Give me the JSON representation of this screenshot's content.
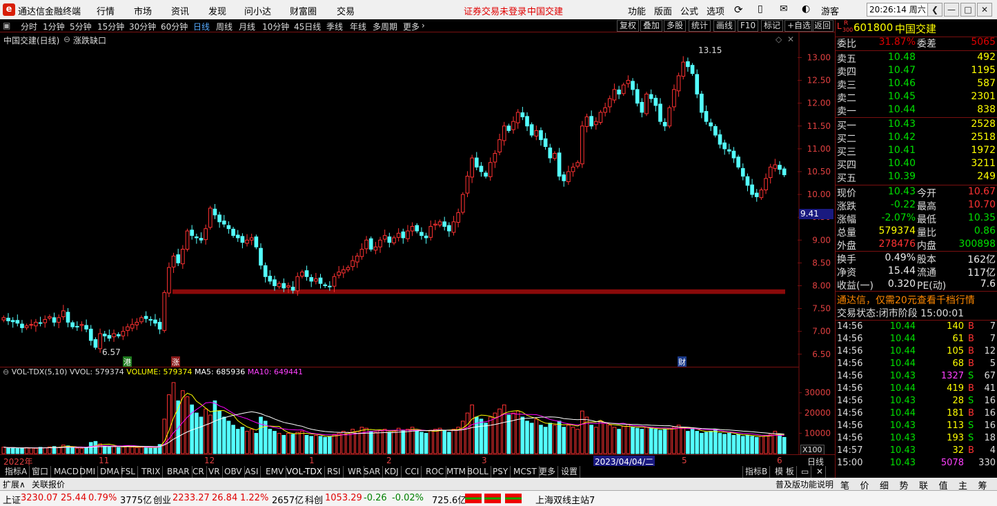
{
  "app": {
    "title": "通达信金融终端",
    "login_status": "证券交易未登录",
    "login_stock": "中国交建",
    "user": "游客",
    "clock": "20:26:14 周六"
  },
  "menus": [
    "行情",
    "市场",
    "资讯",
    "发现",
    "问小达",
    "财富圈",
    "交易"
  ],
  "right_menus": [
    "功能",
    "版面",
    "公式",
    "选项"
  ],
  "periods": [
    "分时",
    "1分钟",
    "5分钟",
    "15分钟",
    "30分钟",
    "60分钟",
    "日线",
    "周线",
    "月线",
    "10分钟",
    "45日线",
    "季线",
    "年线",
    "多周期",
    "更多"
  ],
  "selected_period": "日线",
  "tool_buttons": [
    "复权",
    "叠加",
    "多股",
    "统计",
    "画线",
    "F10",
    "标记",
    "+自选",
    "返回"
  ],
  "chart_title": "中国交建(日线)",
  "chart_indicator": "涨跌缺口",
  "chart_data": {
    "type": "candlestick",
    "title": "中国交建(日线)",
    "ylim": [
      6.3,
      13.4
    ],
    "y_ticks": [
      "13.00",
      "12.50",
      "12.00",
      "11.50",
      "11.00",
      "10.50",
      "10.00",
      "9.50",
      "9.00",
      "8.50",
      "8.00",
      "7.50",
      "7.00",
      "6.50"
    ],
    "x_labels": [
      "2022年",
      "11",
      "12",
      "1",
      "2",
      "3",
      "4",
      "5",
      "6"
    ],
    "cursor_date": "2023/04/04/二",
    "cursor_price": "9.41",
    "max_label": "13.15",
    "min_label": "6.57",
    "gap_band": [
      7.82,
      7.92
    ],
    "markers": [
      "港",
      "涨",
      "财"
    ],
    "closes": [
      7.3,
      7.23,
      7.21,
      7.18,
      7.08,
      7.12,
      7.15,
      7.2,
      7.18,
      7.26,
      7.32,
      7.2,
      7.3,
      7.45,
      7.2,
      7.1,
      7.1,
      7.15,
      7.05,
      6.8,
      6.65,
      6.95,
      6.9,
      6.85,
      6.95,
      6.9,
      7.0,
      7.1,
      7.15,
      7.2,
      7.3,
      7.28,
      7.25,
      7.18,
      7.05,
      7.85,
      8.4,
      8.65,
      8.5,
      8.8,
      9.2,
      9.1,
      9.05,
      9.0,
      9.25,
      9.7,
      9.55,
      9.4,
      9.35,
      9.25,
      9.1,
      9.05,
      8.95,
      9.0,
      9.05,
      8.85,
      8.45,
      8.2,
      8.1,
      8.0,
      8.05,
      7.95,
      8.0,
      7.9,
      8.2,
      8.3,
      8.2,
      8.1,
      8.15,
      8.05,
      8.0,
      7.98,
      8.2,
      8.3,
      8.35,
      8.4,
      8.55,
      8.65,
      8.8,
      9.0,
      8.8,
      8.85,
      9.0,
      9.1,
      8.95,
      9.05,
      9.15,
      9.05,
      9.2,
      9.3,
      9.2,
      9.1,
      9.05,
      9.3,
      9.35,
      9.4,
      9.3,
      9.2,
      9.4,
      9.6,
      10.0,
      10.4,
      10.8,
      10.6,
      10.5,
      10.4,
      10.7,
      10.9,
      11.2,
      11.5,
      11.4,
      11.6,
      11.8,
      11.7,
      11.5,
      11.3,
      11.4,
      11.2,
      11.05,
      10.8,
      10.9,
      10.4,
      10.3,
      10.5,
      10.6,
      10.7,
      11.5,
      11.7,
      11.5,
      11.6,
      11.8,
      11.9,
      12.1,
      12.3,
      12.2,
      12.4,
      12.5,
      12.3,
      12.0,
      11.8,
      12.2,
      12.1,
      11.95,
      11.6,
      11.5,
      11.9,
      12.3,
      12.6,
      12.9,
      12.8,
      12.65,
      12.2,
      11.8,
      11.6,
      11.5,
      11.3,
      11.1,
      11.0,
      10.95,
      10.8,
      10.6,
      10.4,
      10.2,
      10.0,
      9.95,
      10.1,
      10.35,
      10.6,
      10.65,
      10.55,
      10.43
    ],
    "volume": {
      "label": "VOL-TDX(5,10)",
      "vvol": "579374",
      "volume": "579374",
      "ma5": "685936",
      "ma10": "649441",
      "ylim": [
        0,
        36000
      ],
      "y_ticks": [
        "30000",
        "20000",
        "10000"
      ],
      "unit": "X100"
    },
    "volumes": [
      3200,
      2800,
      3000,
      2500,
      2700,
      3000,
      2800,
      2600,
      3100,
      2900,
      3300,
      3500,
      3000,
      4200,
      3800,
      3000,
      2700,
      2600,
      2900,
      5500,
      6000,
      4800,
      3600,
      3200,
      3400,
      3000,
      3500,
      3800,
      3200,
      3000,
      3100,
      2900,
      2800,
      3000,
      4500,
      17000,
      29000,
      35000,
      26000,
      31000,
      28000,
      24000,
      20000,
      18000,
      22000,
      19000,
      26000,
      21000,
      18000,
      16000,
      14000,
      12000,
      13000,
      11000,
      12000,
      10000,
      18000,
      16000,
      12000,
      11000,
      10000,
      9000,
      10000,
      9500,
      10500,
      11000,
      9000,
      8500,
      9000,
      8500,
      8000,
      8500,
      9500,
      10000,
      11000,
      10500,
      12000,
      11000,
      13000,
      12500,
      11000,
      10500,
      11500,
      12000,
      10500,
      11000,
      12500,
      11500,
      12000,
      13000,
      11000,
      10500,
      10000,
      11500,
      12000,
      12500,
      11500,
      10500,
      12000,
      13000,
      16000,
      20000,
      24000,
      18000,
      17000,
      15000,
      18000,
      20000,
      22000,
      24000,
      19000,
      20000,
      21000,
      18000,
      16000,
      15000,
      17000,
      14000,
      13000,
      15000,
      14000,
      16000,
      13000,
      14000,
      13000,
      12000,
      21000,
      18000,
      14000,
      13000,
      16000,
      15000,
      14000,
      13000,
      12000,
      13500,
      14500,
      13000,
      12500,
      12000,
      13000,
      12500,
      12000,
      11500,
      12000,
      12500,
      13000,
      14000,
      12500,
      11000,
      12000,
      11000,
      10000,
      10500,
      11000,
      12000,
      10000,
      9500,
      10000,
      9000,
      9500,
      8500,
      9000,
      8500,
      8000,
      8500,
      9000,
      9500,
      11000,
      9500,
      8000
    ]
  },
  "quote": {
    "code": "601800",
    "name": "中国交建",
    "tag": "L",
    "tag_r": "R",
    "tag_n": "300",
    "weibi_label": "委比",
    "weibi": "31.87%",
    "weicha_label": "委差",
    "weicha": "5065",
    "asks": [
      {
        "label": "卖五",
        "price": "10.48",
        "vol": "492"
      },
      {
        "label": "卖四",
        "price": "10.47",
        "vol": "1195"
      },
      {
        "label": "卖三",
        "price": "10.46",
        "vol": "587"
      },
      {
        "label": "卖二",
        "price": "10.45",
        "vol": "2301"
      },
      {
        "label": "卖一",
        "price": "10.44",
        "vol": "838"
      }
    ],
    "bids": [
      {
        "label": "买一",
        "price": "10.43",
        "vol": "2528"
      },
      {
        "label": "买二",
        "price": "10.42",
        "vol": "2518"
      },
      {
        "label": "买三",
        "price": "10.41",
        "vol": "1972"
      },
      {
        "label": "买四",
        "price": "10.40",
        "vol": "3211"
      },
      {
        "label": "买五",
        "price": "10.39",
        "vol": "249"
      }
    ],
    "stats": [
      {
        "l1": "现价",
        "v1": "10.43",
        "c1": "green",
        "l2": "今开",
        "v2": "10.67",
        "c2": "red"
      },
      {
        "l1": "涨跌",
        "v1": "-0.22",
        "c1": "green",
        "l2": "最高",
        "v2": "10.70",
        "c2": "red"
      },
      {
        "l1": "涨幅",
        "v1": "-2.07%",
        "c1": "green",
        "l2": "最低",
        "v2": "10.35",
        "c2": "green"
      },
      {
        "l1": "总量",
        "v1": "579374",
        "c1": "yellow",
        "l2": "量比",
        "v2": "0.86",
        "c2": "green"
      },
      {
        "l1": "外盘",
        "v1": "278476",
        "c1": "red",
        "l2": "内盘",
        "v2": "300898",
        "c2": "green"
      }
    ],
    "stats2": [
      {
        "l1": "换手",
        "v1": "0.49%",
        "l2": "股本",
        "v2": "162亿"
      },
      {
        "l1": "净资",
        "v1": "15.44",
        "l2": "流通",
        "v2": "117亿"
      },
      {
        "l1": "收益(一)",
        "v1": "0.320",
        "l2": "PE(动)",
        "v2": "7.6"
      }
    ],
    "ad": "通达信，仅需20元查看千档行情",
    "trade_status": "交易状态:闭市阶段 15:00:01",
    "ticks": [
      {
        "t": "14:56",
        "p": "10.44",
        "v": "140",
        "vc": "yellow",
        "s": "B",
        "n": "7"
      },
      {
        "t": "14:56",
        "p": "10.44",
        "v": "61",
        "vc": "yellow",
        "s": "B",
        "n": "7"
      },
      {
        "t": "14:56",
        "p": "10.44",
        "v": "105",
        "vc": "yellow",
        "s": "B",
        "n": "12"
      },
      {
        "t": "14:56",
        "p": "10.44",
        "v": "68",
        "vc": "yellow",
        "s": "B",
        "n": "5"
      },
      {
        "t": "14:56",
        "p": "10.43",
        "v": "1327",
        "vc": "mag",
        "s": "S",
        "n": "67"
      },
      {
        "t": "14:56",
        "p": "10.44",
        "v": "419",
        "vc": "yellow",
        "s": "B",
        "n": "41"
      },
      {
        "t": "14:56",
        "p": "10.43",
        "v": "28",
        "vc": "yellow",
        "s": "S",
        "n": "16"
      },
      {
        "t": "14:56",
        "p": "10.44",
        "v": "181",
        "vc": "yellow",
        "s": "B",
        "n": "16"
      },
      {
        "t": "14:56",
        "p": "10.43",
        "v": "113",
        "vc": "yellow",
        "s": "S",
        "n": "16"
      },
      {
        "t": "14:56",
        "p": "10.43",
        "v": "193",
        "vc": "yellow",
        "s": "S",
        "n": "18"
      },
      {
        "t": "14:57",
        "p": "10.43",
        "v": "32",
        "vc": "yellow",
        "s": "B",
        "n": "4"
      },
      {
        "t": "15:00",
        "p": "10.43",
        "v": "5078",
        "vc": "mag",
        "s": "",
        "n": "330"
      }
    ],
    "right_tabs": [
      "笔",
      "价",
      "细",
      "势",
      "联",
      "值",
      "主",
      "筹"
    ]
  },
  "indicator_tabs": [
    "指标A",
    "窗口",
    "MACD",
    "DMI",
    "DMA",
    "FSL",
    "TRIX",
    "BRAR",
    "CR",
    "VR",
    "OBV",
    "ASI",
    "EMV",
    "VOL-TDX",
    "RSI",
    "WR",
    "SAR",
    "KDJ",
    "CCI",
    "ROC",
    "MTM",
    "BOLL",
    "PSY",
    "MCST",
    "更多",
    "设置"
  ],
  "indicator_b": "指标B",
  "template_label": "模 板",
  "period_right": "日线",
  "ext_left": "扩展∧",
  "ext_link": "关联报价",
  "ext_right": "普及版功能说明",
  "status": {
    "sh_label": "上证",
    "sh_val": "3230.07",
    "sh_chg": "25.44",
    "sh_pct": "0.79%",
    "sh_amt": "3775亿",
    "cy_label": "创业",
    "cy_val": "2233.27",
    "cy_chg": "26.84",
    "cy_pct": "1.22%",
    "cy_amt": "2657亿",
    "kc_label": "科创",
    "kc_val": "1053.29",
    "kc_chg": "-0.26",
    "kc_pct": "-0.02%",
    "kc_amt": "725.6亿",
    "server": "上海双线主站7"
  },
  "colors": {
    "up": "#ff3232",
    "down": "#54ffff",
    "ma5": "#ffffff",
    "ma10": "#ffff00",
    "ma20": "#ff00ff",
    "accent": "#7a1010"
  }
}
